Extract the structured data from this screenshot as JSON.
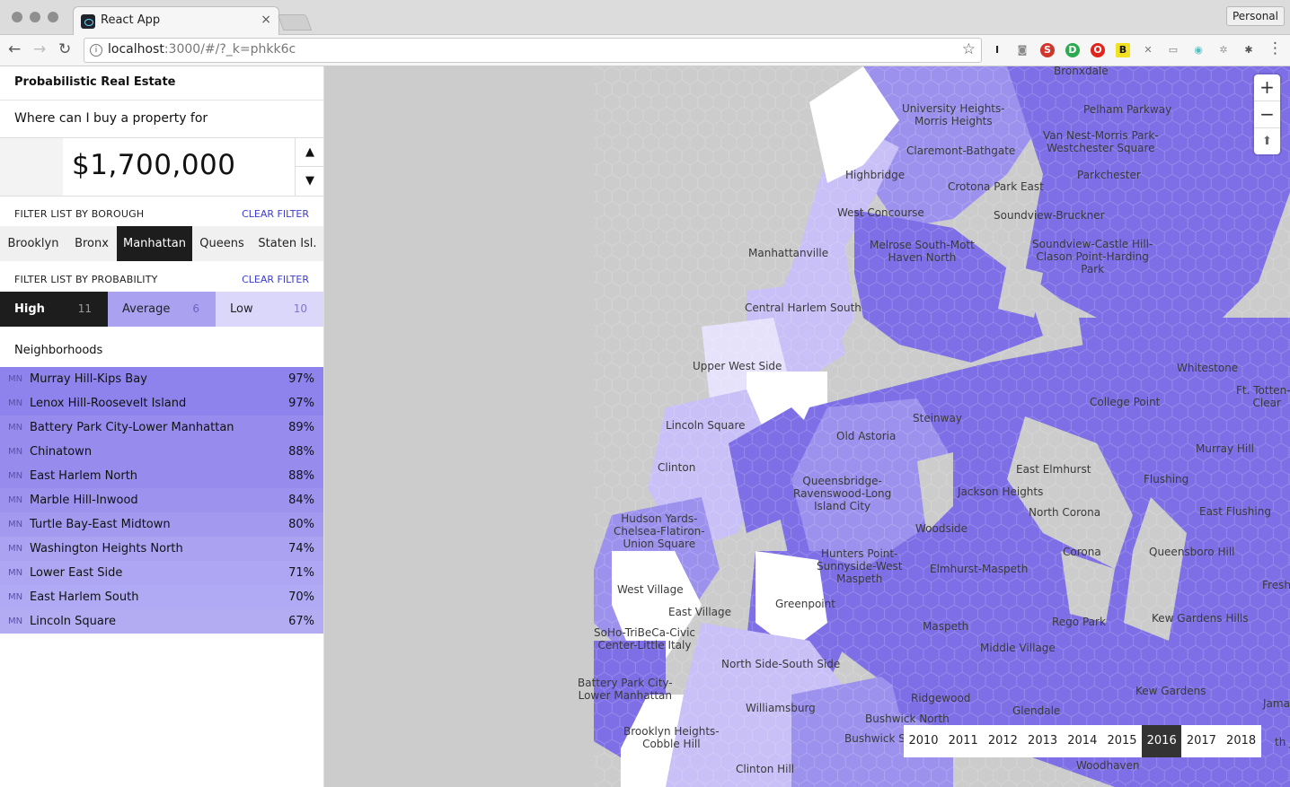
{
  "browser": {
    "tab_title": "React App",
    "tab_close": "×",
    "profile_label": "Personal",
    "url_host": "localhost",
    "url_rest": ":3000/#/?_k=phkk6c",
    "nav": {
      "back": "←",
      "forward": "→",
      "reload": "↻"
    },
    "extensions": [
      {
        "name": "instapaper-icon",
        "glyph": "I",
        "color": "#222222"
      },
      {
        "name": "camera-icon",
        "glyph": "◙",
        "color": "#8a8a8a"
      },
      {
        "name": "s-extension-icon",
        "glyph": "S",
        "color": "#d2352b"
      },
      {
        "name": "d-extension-icon",
        "glyph": "D",
        "color": "#2da94f"
      },
      {
        "name": "opera-icon",
        "glyph": "O",
        "color": "#e0241b"
      },
      {
        "name": "b-extension-icon",
        "glyph": "B",
        "color": "#f2e021"
      },
      {
        "name": "pin-icon",
        "glyph": "✕",
        "color": "#7a7a7a"
      },
      {
        "name": "cast-icon",
        "glyph": "▭",
        "color": "#7a7a7a"
      },
      {
        "name": "color-picker-icon",
        "glyph": "◉",
        "color": "#55c1c1"
      },
      {
        "name": "settings-extension-icon",
        "glyph": "✲",
        "color": "#9a9a9a"
      },
      {
        "name": "bug-icon",
        "glyph": "✱",
        "color": "#555555"
      }
    ],
    "menu_glyph": "⋮"
  },
  "app": {
    "title": "Probabilistic Real Estate",
    "question": "Where can I buy a property for",
    "price": "$1,700,000",
    "spin_up": "▲",
    "spin_down": "▼",
    "borough_filter_label": "FILTER LIST BY BOROUGH",
    "probability_filter_label": "FILTER LIST BY PROBABILITY",
    "clear_filter": "CLEAR FILTER",
    "boroughs": [
      "Brooklyn",
      "Bronx",
      "Manhattan",
      "Queens",
      "Staten Isl."
    ],
    "active_borough": "Manhattan",
    "probabilities": [
      {
        "label": "High",
        "count": "11",
        "active": true,
        "bg": "#1d1d1d",
        "fg": "#ffffff",
        "count_fg": "#9b9b9b"
      },
      {
        "label": "Average",
        "count": "6",
        "active": false,
        "bg": "#aaa2f0",
        "fg": "#222222",
        "count_fg": "#6c64c0"
      },
      {
        "label": "Low",
        "count": "10",
        "active": false,
        "bg": "#dbd7fa",
        "fg": "#222222",
        "count_fg": "#7e76c8"
      }
    ],
    "neighborhoods_title": "Neighborhoods",
    "neighborhoods": [
      {
        "boro": "MN",
        "name": "Murray Hill-Kips Bay",
        "pct": "97%",
        "bg": "#8e83ec"
      },
      {
        "boro": "MN",
        "name": "Lenox Hill-Roosevelt Island",
        "pct": "97%",
        "bg": "#8e83ec"
      },
      {
        "boro": "MN",
        "name": "Battery Park City-Lower Manhattan",
        "pct": "89%",
        "bg": "#978cee"
      },
      {
        "boro": "MN",
        "name": "Chinatown",
        "pct": "88%",
        "bg": "#978cee"
      },
      {
        "boro": "MN",
        "name": "East Harlem North",
        "pct": "88%",
        "bg": "#978cee"
      },
      {
        "boro": "MN",
        "name": "Marble Hill-Inwood",
        "pct": "84%",
        "bg": "#9d93ef"
      },
      {
        "boro": "MN",
        "name": "Turtle Bay-East Midtown",
        "pct": "80%",
        "bg": "#a39af0"
      },
      {
        "boro": "MN",
        "name": "Washington Heights North",
        "pct": "74%",
        "bg": "#aba3f2"
      },
      {
        "boro": "MN",
        "name": "Lower East Side",
        "pct": "71%",
        "bg": "#aea6f2"
      },
      {
        "boro": "MN",
        "name": "East Harlem South",
        "pct": "70%",
        "bg": "#b0a9f3"
      },
      {
        "boro": "MN",
        "name": "Lincoln Square",
        "pct": "67%",
        "bg": "#b3acf3"
      }
    ]
  },
  "map": {
    "zoom_in": "+",
    "zoom_out": "−",
    "compass": "⬆",
    "colors": {
      "water": "#cccccc",
      "high": "#7f6fe6",
      "mid": "#9d91ee",
      "low": "#c8c0f6",
      "very_low": "#e6e2fb",
      "none": "#ffffff"
    },
    "labels": [
      "Bronxdale",
      "University Heights-\nMorris Heights",
      "Pelham Parkway",
      "Van Nest-Morris Park-\nWestchester Square",
      "Claremont-Bathgate",
      "Highbridge",
      "Parkchester",
      "Crotona Park East",
      "West Concourse",
      "Soundview-Bruckner",
      "Manhattanville",
      "Melrose South-Mott\nHaven North",
      "Soundview-Castle Hill-\nClason Point-Harding\nPark",
      "Central Harlem South",
      "Upper West Side",
      "Whitestone",
      "Ft. Totten-B\nClear",
      "College Point",
      "Steinway",
      "Lincoln Square",
      "Old Astoria",
      "Murray Hill",
      "Clinton",
      "East Elmhurst",
      "Queensbridge-\nRavenswood-Long\nIsland City",
      "Jackson Heights",
      "Flushing",
      "North Corona",
      "East Flushing",
      "Hudson Yards-\nChelsea-Flatiron-\nUnion Square",
      "Woodside",
      "Corona",
      "Queensboro Hill",
      "Hunters Point-\nSunnyside-West\nMaspeth",
      "Elmhurst-Maspeth",
      "West Village",
      "Fresh Me",
      "Greenpoint",
      "East Village",
      "Maspeth",
      "Rego Park",
      "Kew Gardens Hills",
      "SoHo-TriBeCa-Civic\nCenter-Little Italy",
      "Middle Village",
      "North Side-South Side",
      "Battery Park City-\nLower Manhattan",
      "Kew Gardens",
      "Ridgewood",
      "Jamaica",
      "Williamsburg",
      "Glendale",
      "Bushwick North",
      "Brooklyn Heights-\nCobble Hill",
      "Bushwick So",
      "th Jam",
      "Clinton Hill",
      "Woodhaven"
    ],
    "years": [
      "2010",
      "2011",
      "2012",
      "2013",
      "2014",
      "2015",
      "2016",
      "2017",
      "2018"
    ],
    "active_year": "2016"
  }
}
